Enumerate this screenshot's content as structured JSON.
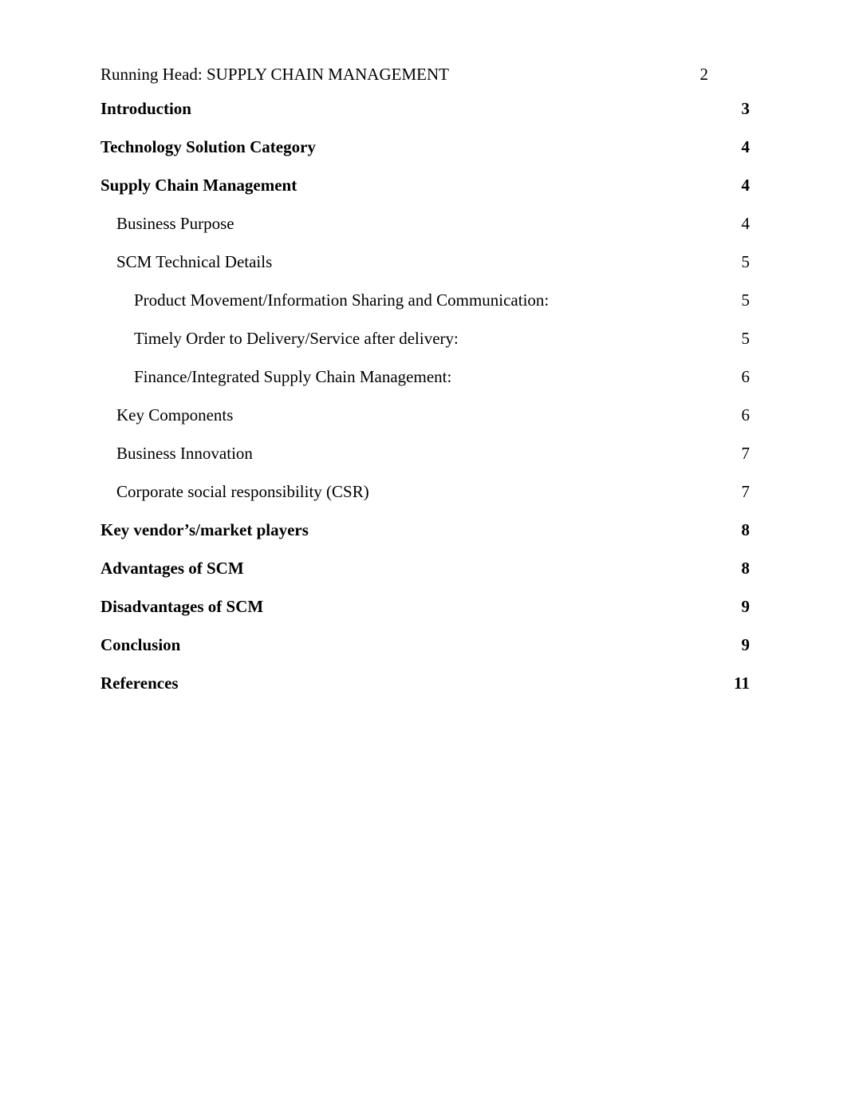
{
  "header": {
    "running_head": "Running Head: SUPPLY CHAIN MANAGEMENT",
    "page_number": "2"
  },
  "toc": {
    "entries": [
      {
        "title": "Introduction",
        "page": "3",
        "level": 1
      },
      {
        "title": "Technology Solution Category",
        "page": "4",
        "level": 1
      },
      {
        "title": "Supply Chain Management",
        "page": "4",
        "level": 1
      },
      {
        "title": "Business Purpose",
        "page": "4",
        "level": 2
      },
      {
        "title": "SCM Technical Details",
        "page": "5",
        "level": 2
      },
      {
        "title": "Product Movement/Information Sharing and Communication:",
        "page": "5",
        "level": 3
      },
      {
        "title": "Timely Order to Delivery/Service after delivery:",
        "page": "5",
        "level": 3
      },
      {
        "title": "Finance/Integrated Supply Chain Management:",
        "page": "6",
        "level": 3
      },
      {
        "title": "Key Components",
        "page": "6",
        "level": 2
      },
      {
        "title": "Business Innovation",
        "page": "7",
        "level": 2
      },
      {
        "title": "Corporate social responsibility (CSR)",
        "page": "7",
        "level": 2
      },
      {
        "title": "Key vendor’s/market players",
        "page": "8",
        "level": 1
      },
      {
        "title": "Advantages of SCM",
        "page": "8",
        "level": 1
      },
      {
        "title": "Disadvantages of SCM",
        "page": "9",
        "level": 1
      },
      {
        "title": "Conclusion",
        "page": "9",
        "level": 1
      },
      {
        "title": "References",
        "page": "11",
        "level": 1
      }
    ]
  }
}
